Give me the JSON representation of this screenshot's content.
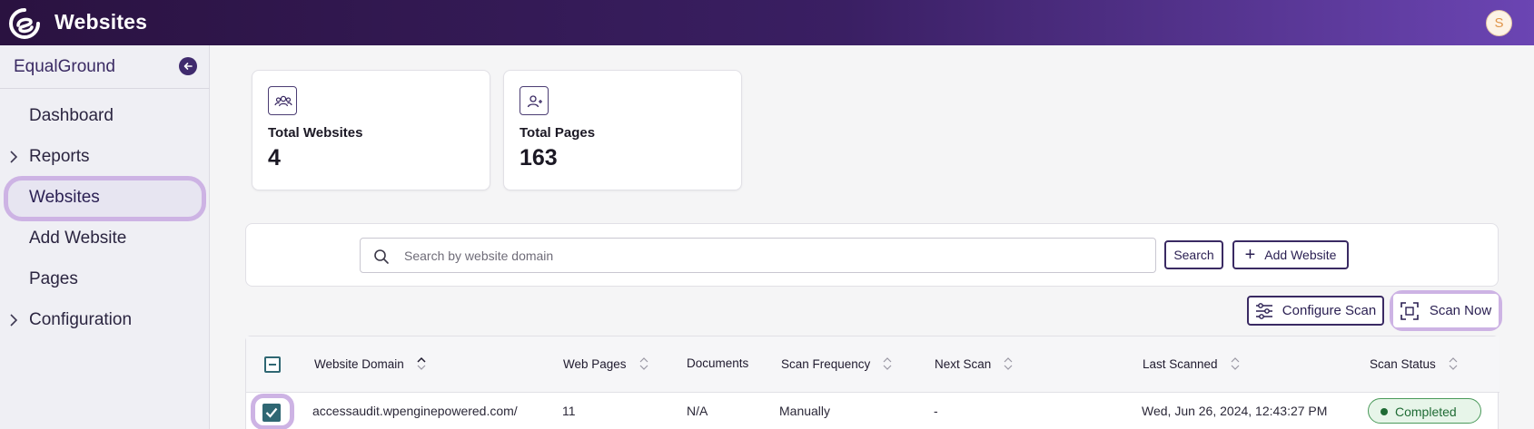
{
  "header": {
    "title": "Websites",
    "avatar_initial": "S"
  },
  "sidebar": {
    "org_name": "EqualGround",
    "items": [
      {
        "label": "Dashboard",
        "expandable": false,
        "active": false
      },
      {
        "label": "Reports",
        "expandable": true,
        "active": false
      },
      {
        "label": "Websites",
        "expandable": false,
        "active": true
      },
      {
        "label": "Add Website",
        "expandable": false,
        "active": false
      },
      {
        "label": "Pages",
        "expandable": false,
        "active": false
      },
      {
        "label": "Configuration",
        "expandable": true,
        "active": false
      }
    ]
  },
  "stats": [
    {
      "label": "Total Websites",
      "value": "4",
      "icon": "users-icon"
    },
    {
      "label": "Total Pages",
      "value": "163",
      "icon": "user-add-icon"
    }
  ],
  "search": {
    "placeholder": "Search by website domain",
    "value": "",
    "button_label": "Search",
    "add_label": "Add Website"
  },
  "actions": {
    "configure_label": "Configure Scan",
    "scan_now_label": "Scan Now"
  },
  "table": {
    "columns": [
      {
        "label": "Website Domain",
        "sortable": true
      },
      {
        "label": "Web Pages",
        "sortable": true
      },
      {
        "label": "Documents",
        "sortable": false
      },
      {
        "label": "Scan Frequency",
        "sortable": true
      },
      {
        "label": "Next Scan",
        "sortable": true
      },
      {
        "label": "Last Scanned",
        "sortable": true
      },
      {
        "label": "Scan Status",
        "sortable": true
      }
    ],
    "rows": [
      {
        "domain": "accessaudit.wpenginepowered.com/",
        "web_pages": "11",
        "documents": "N/A",
        "frequency": "Manually",
        "next_scan": "-",
        "last_scanned": "Wed, Jun 26, 2024, 12:43:27 PM",
        "status": "Completed",
        "checked": true
      }
    ]
  },
  "colors": {
    "accent": "#3a2a63",
    "highlight": "#cdb3e4",
    "status_completed": "#1f6b34"
  }
}
